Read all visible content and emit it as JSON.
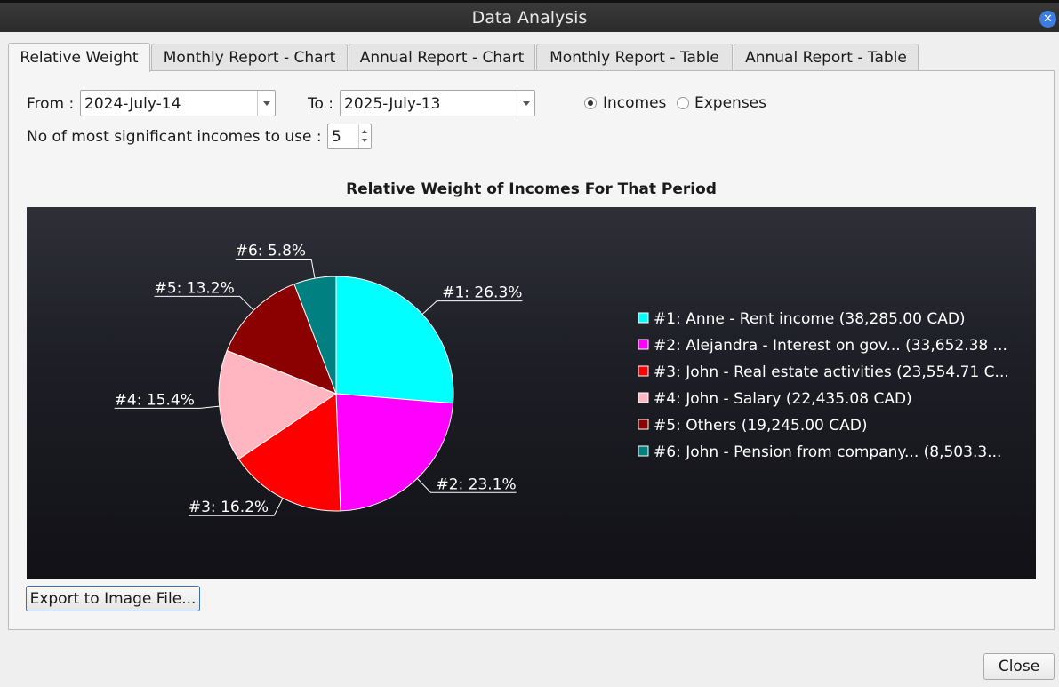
{
  "window": {
    "title": "Data Analysis"
  },
  "tabs": [
    {
      "label": "Relative Weight"
    },
    {
      "label": "Monthly Report - Chart"
    },
    {
      "label": "Annual Report - Chart"
    },
    {
      "label": "Monthly Report - Table"
    },
    {
      "label": "Annual Report - Table"
    }
  ],
  "filters": {
    "from_label": "From :",
    "from_value": "2024-July-14",
    "to_label": "To :",
    "to_value": "2025-July-13",
    "incomes_label": "Incomes",
    "expenses_label": "Expenses",
    "selected_type": "Incomes",
    "count_label": "No of most significant incomes to use :",
    "count_value": "5"
  },
  "chart_data": {
    "type": "pie",
    "title": "Relative Weight of Incomes For That Period",
    "slices": [
      {
        "label": "#1: 26.3%",
        "legend": "#1: Anne - Rent income (38,285.00 CAD)",
        "value": 26.3,
        "color": "#00ffff"
      },
      {
        "label": "#2: 23.1%",
        "legend": "#2: Alejandra - Interest on gov... (33,652.38 ...",
        "value": 23.1,
        "color": "#ff00ff"
      },
      {
        "label": "#3: 16.2%",
        "legend": "#3: John - Real estate activities (23,554.71 C...",
        "value": 16.2,
        "color": "#ff0000"
      },
      {
        "label": "#4: 15.4%",
        "legend": "#4: John - Salary (22,435.08 CAD)",
        "value": 15.4,
        "color": "#ffb6c1"
      },
      {
        "label": "#5: 13.2%",
        "legend": "#5: Others (19,245.00 CAD)",
        "value": 13.2,
        "color": "#8b0000"
      },
      {
        "label": "#6: 5.8%",
        "legend": "#6: John - Pension from company... (8,503.3...",
        "value": 5.8,
        "color": "#008080"
      }
    ],
    "legend_position": "right"
  },
  "actions": {
    "export_label": "Export to Image File...",
    "close_label": "Close"
  }
}
